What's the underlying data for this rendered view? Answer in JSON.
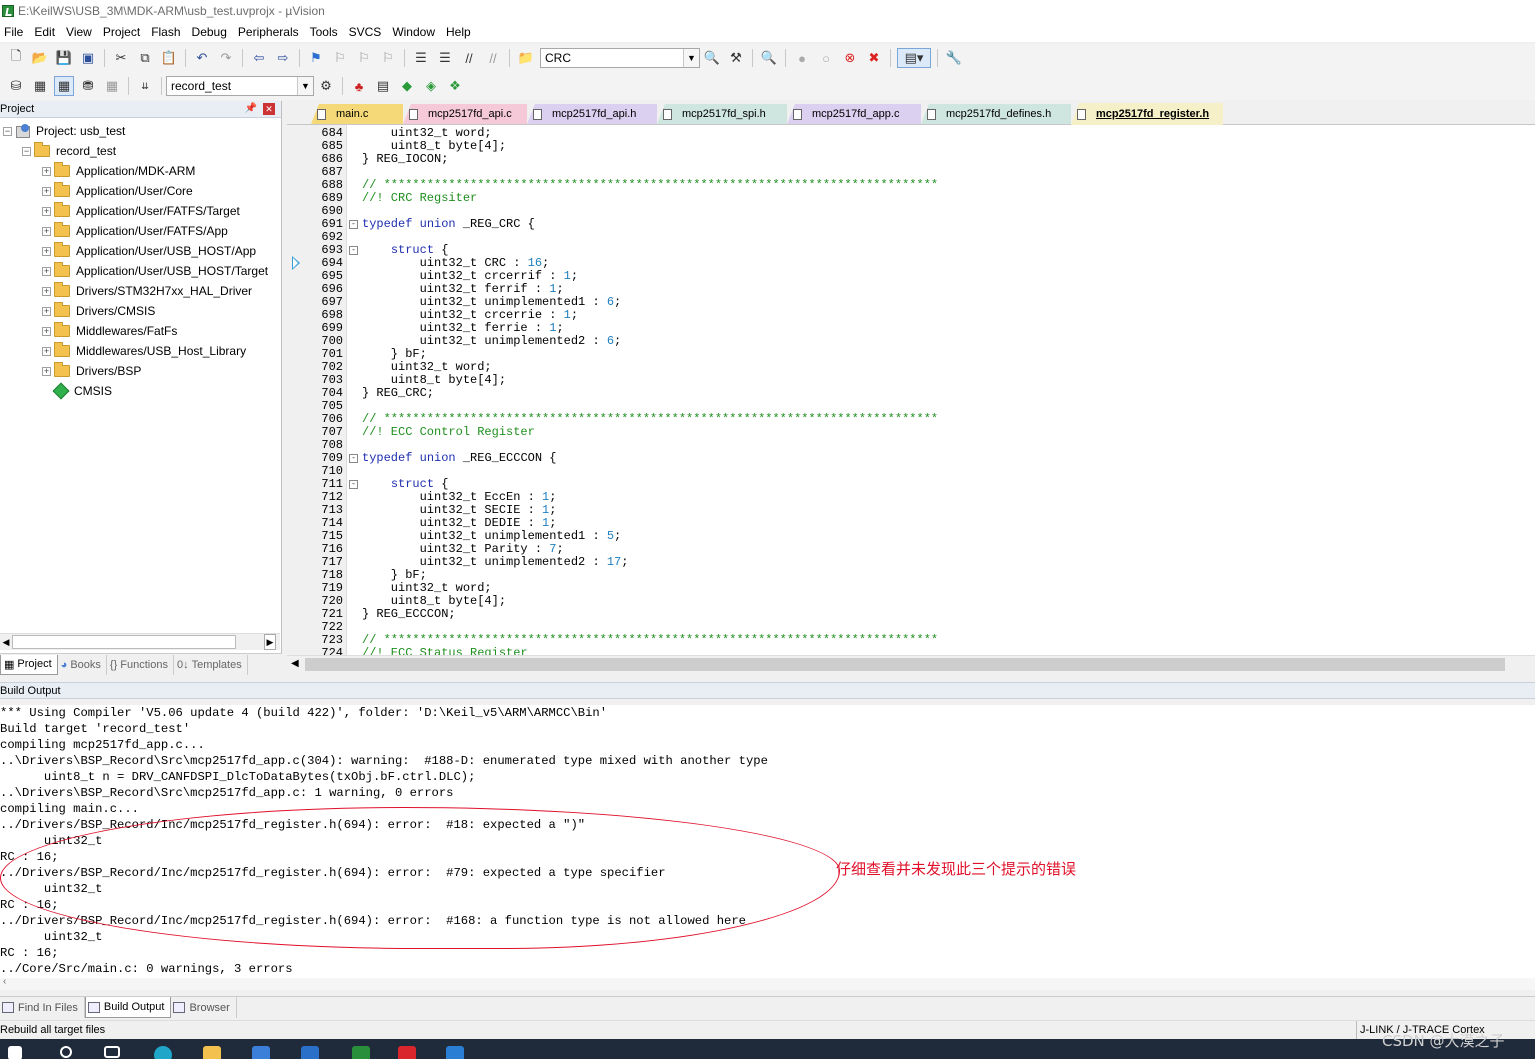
{
  "window": {
    "title": "E:\\KeilWS\\USB_3M\\MDK-ARM\\usb_test.uvprojx - µVision"
  },
  "menu": [
    "File",
    "Edit",
    "View",
    "Project",
    "Flash",
    "Debug",
    "Peripherals",
    "Tools",
    "SVCS",
    "Window",
    "Help"
  ],
  "toolbar": {
    "find_value": "CRC",
    "target_value": "record_test"
  },
  "project": {
    "header": "Project",
    "root": "Project: usb_test",
    "target": "record_test",
    "groups": [
      "Application/MDK-ARM",
      "Application/User/Core",
      "Application/User/FATFS/Target",
      "Application/User/FATFS/App",
      "Application/User/USB_HOST/App",
      "Application/User/USB_HOST/Target",
      "Drivers/STM32H7xx_HAL_Driver",
      "Drivers/CMSIS",
      "Middlewares/FatFs",
      "Middlewares/USB_Host_Library",
      "Drivers/BSP"
    ],
    "component": "CMSIS",
    "tabs": [
      "Project",
      "Books",
      "Functions",
      "Templates"
    ]
  },
  "editor": {
    "tabs": [
      {
        "label": "main.c",
        "color": "#f5d978"
      },
      {
        "label": "mcp2517fd_api.c",
        "color": "#f5c9d8"
      },
      {
        "label": "mcp2517fd_api.h",
        "color": "#dcd0f0"
      },
      {
        "label": "mcp2517fd_spi.h",
        "color": "#cfe5e0"
      },
      {
        "label": "mcp2517fd_app.c",
        "color": "#dcd0f0"
      },
      {
        "label": "mcp2517fd_defines.h",
        "color": "#cfe5e0"
      },
      {
        "label": "mcp2517fd_register.h",
        "color": "#f5f0c8",
        "active": true
      }
    ],
    "lines": [
      {
        "n": "684",
        "t": [
          [
            "    uint32_t word;",
            "pun"
          ]
        ]
      },
      {
        "n": "685",
        "t": [
          [
            "    uint8_t byte[4];",
            "pun"
          ]
        ]
      },
      {
        "n": "686",
        "t": [
          [
            "} REG_IOCON;",
            "pun"
          ]
        ]
      },
      {
        "n": "687",
        "t": []
      },
      {
        "n": "688",
        "t": [
          [
            "// *****************************************************************************",
            "cm"
          ]
        ]
      },
      {
        "n": "689",
        "t": [
          [
            "//! CRC Regsiter",
            "cm"
          ]
        ]
      },
      {
        "n": "690",
        "t": []
      },
      {
        "n": "691",
        "fold": "-",
        "t": [
          [
            "typedef",
            "kw"
          ],
          [
            " ",
            "pun"
          ],
          [
            "union",
            "kw"
          ],
          [
            " _REG_CRC {",
            "pun"
          ]
        ]
      },
      {
        "n": "692",
        "t": []
      },
      {
        "n": "693",
        "fold": "-",
        "t": [
          [
            "    ",
            "pun"
          ],
          [
            "struct",
            "kw"
          ],
          [
            " {",
            "pun"
          ]
        ]
      },
      {
        "n": "694",
        "t": [
          [
            "        uint32_t CRC : ",
            "pun"
          ],
          [
            "16",
            "num"
          ],
          [
            ";",
            "pun"
          ]
        ]
      },
      {
        "n": "695",
        "t": [
          [
            "        uint32_t crcerrif : ",
            "pun"
          ],
          [
            "1",
            "num"
          ],
          [
            ";",
            "pun"
          ]
        ]
      },
      {
        "n": "696",
        "t": [
          [
            "        uint32_t ferrif : ",
            "pun"
          ],
          [
            "1",
            "num"
          ],
          [
            ";",
            "pun"
          ]
        ]
      },
      {
        "n": "697",
        "t": [
          [
            "        uint32_t unimplemented1 : ",
            "pun"
          ],
          [
            "6",
            "num"
          ],
          [
            ";",
            "pun"
          ]
        ]
      },
      {
        "n": "698",
        "t": [
          [
            "        uint32_t crcerrie : ",
            "pun"
          ],
          [
            "1",
            "num"
          ],
          [
            ";",
            "pun"
          ]
        ]
      },
      {
        "n": "699",
        "t": [
          [
            "        uint32_t ferrie : ",
            "pun"
          ],
          [
            "1",
            "num"
          ],
          [
            ";",
            "pun"
          ]
        ]
      },
      {
        "n": "700",
        "t": [
          [
            "        uint32_t unimplemented2 : ",
            "pun"
          ],
          [
            "6",
            "num"
          ],
          [
            ";",
            "pun"
          ]
        ]
      },
      {
        "n": "701",
        "t": [
          [
            "    } bF;",
            "pun"
          ]
        ]
      },
      {
        "n": "702",
        "t": [
          [
            "    uint32_t word;",
            "pun"
          ]
        ]
      },
      {
        "n": "703",
        "t": [
          [
            "    uint8_t byte[4];",
            "pun"
          ]
        ]
      },
      {
        "n": "704",
        "t": [
          [
            "} REG_CRC;",
            "pun"
          ]
        ]
      },
      {
        "n": "705",
        "t": []
      },
      {
        "n": "706",
        "t": [
          [
            "// *****************************************************************************",
            "cm"
          ]
        ]
      },
      {
        "n": "707",
        "t": [
          [
            "//! ECC Control Register",
            "cm"
          ]
        ]
      },
      {
        "n": "708",
        "t": []
      },
      {
        "n": "709",
        "fold": "-",
        "t": [
          [
            "typedef",
            "kw"
          ],
          [
            " ",
            "pun"
          ],
          [
            "union",
            "kw"
          ],
          [
            " _REG_ECCCON {",
            "pun"
          ]
        ]
      },
      {
        "n": "710",
        "t": []
      },
      {
        "n": "711",
        "fold": "-",
        "t": [
          [
            "    ",
            "pun"
          ],
          [
            "struct",
            "kw"
          ],
          [
            " {",
            "pun"
          ]
        ]
      },
      {
        "n": "712",
        "t": [
          [
            "        uint32_t EccEn : ",
            "pun"
          ],
          [
            "1",
            "num"
          ],
          [
            ";",
            "pun"
          ]
        ]
      },
      {
        "n": "713",
        "t": [
          [
            "        uint32_t SECIE : ",
            "pun"
          ],
          [
            "1",
            "num"
          ],
          [
            ";",
            "pun"
          ]
        ]
      },
      {
        "n": "714",
        "t": [
          [
            "        uint32_t DEDIE : ",
            "pun"
          ],
          [
            "1",
            "num"
          ],
          [
            ";",
            "pun"
          ]
        ]
      },
      {
        "n": "715",
        "t": [
          [
            "        uint32_t unimplemented1 : ",
            "pun"
          ],
          [
            "5",
            "num"
          ],
          [
            ";",
            "pun"
          ]
        ]
      },
      {
        "n": "716",
        "t": [
          [
            "        uint32_t Parity : ",
            "pun"
          ],
          [
            "7",
            "num"
          ],
          [
            ";",
            "pun"
          ]
        ]
      },
      {
        "n": "717",
        "t": [
          [
            "        uint32_t unimplemented2 : ",
            "pun"
          ],
          [
            "17",
            "num"
          ],
          [
            ";",
            "pun"
          ]
        ]
      },
      {
        "n": "718",
        "t": [
          [
            "    } bF;",
            "pun"
          ]
        ]
      },
      {
        "n": "719",
        "t": [
          [
            "    uint32_t word;",
            "pun"
          ]
        ]
      },
      {
        "n": "720",
        "t": [
          [
            "    uint8_t byte[4];",
            "pun"
          ]
        ]
      },
      {
        "n": "721",
        "t": [
          [
            "} REG_ECCCON;",
            "pun"
          ]
        ]
      },
      {
        "n": "722",
        "t": []
      },
      {
        "n": "723",
        "t": [
          [
            "// *****************************************************************************",
            "cm"
          ]
        ]
      },
      {
        "n": "724",
        "t": [
          [
            "//! ECC Status Register",
            "cm"
          ]
        ]
      }
    ]
  },
  "build": {
    "header": "Build Output",
    "lines": [
      "*** Using Compiler 'V5.06 update 4 (build 422)', folder: 'D:\\Keil_v5\\ARM\\ARMCC\\Bin'",
      "Build target 'record_test'",
      "compiling mcp2517fd_app.c...",
      "..\\Drivers\\BSP_Record\\Src\\mcp2517fd_app.c(304): warning:  #188-D: enumerated type mixed with another type",
      "      uint8_t n = DRV_CANFDSPI_DlcToDataBytes(txObj.bF.ctrl.DLC);",
      "..\\Drivers\\BSP_Record\\Src\\mcp2517fd_app.c: 1 warning, 0 errors",
      "compiling main.c...",
      "../Drivers/BSP_Record/Inc/mcp2517fd_register.h(694): error:  #18: expected a \")\"",
      "      uint32_t",
      "RC : 16;",
      "../Drivers/BSP_Record/Inc/mcp2517fd_register.h(694): error:  #79: expected a type specifier",
      "      uint32_t",
      "RC : 16;",
      "../Drivers/BSP_Record/Inc/mcp2517fd_register.h(694): error:  #168: a function type is not allowed here",
      "      uint32_t",
      "RC : 16;",
      "../Core/Src/main.c: 0 warnings, 3 errors"
    ],
    "annotation": "仔细查看并未发现此三个提示的错误"
  },
  "bottom_tabs": [
    "Find In Files",
    "Build Output",
    "Browser"
  ],
  "status": {
    "left": "Rebuild all target files",
    "right": "J-LINK / J-TRACE Cortex"
  },
  "watermark": "CSDN @大漠之子"
}
